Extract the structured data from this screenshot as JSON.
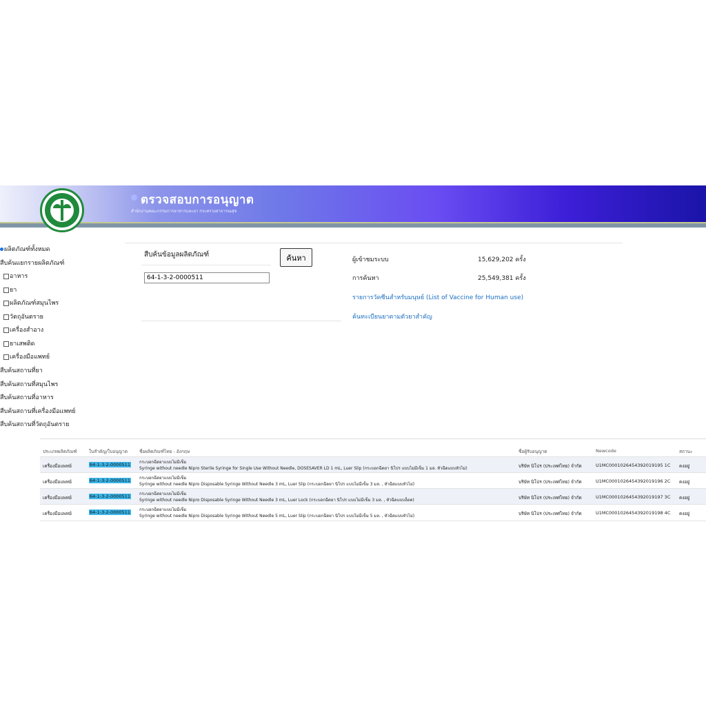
{
  "header": {
    "title": "ตรวจสอบการอนุญาต",
    "subtitle": "สำนักงานคณะกรรมการอาหารและยา กระทรวงสาธารณสุข"
  },
  "sidebar": {
    "items": [
      {
        "label": "ผลิตภัณฑ์ทั้งหมด",
        "control": "radio"
      },
      {
        "label": "สืบค้นแยกรายผลิตภัณฑ์",
        "control": "none"
      },
      {
        "label": "อาหาร",
        "control": "checkbox"
      },
      {
        "label": "ยา",
        "control": "checkbox"
      },
      {
        "label": "ผลิตภัณฑ์สมุนไพร",
        "control": "checkbox"
      },
      {
        "label": "วัตถุอันตราย",
        "control": "checkbox"
      },
      {
        "label": "เครื่องสำอาง",
        "control": "checkbox"
      },
      {
        "label": "ยาเสพติด",
        "control": "checkbox"
      },
      {
        "label": "เครื่องมือแพทย์",
        "control": "checkbox"
      },
      {
        "label": "สืบค้นสถานที่ยา",
        "control": "none"
      },
      {
        "label": "สืบค้นสถานที่สมุนไพร",
        "control": "none"
      },
      {
        "label": "สืบค้นสถานที่อาหาร",
        "control": "none"
      },
      {
        "label": "สืบค้นสถานที่เครื่องมือแพทย์",
        "control": "none"
      },
      {
        "label": "สืบค้นสถานที่วัตถุอันตราย",
        "control": "none"
      }
    ]
  },
  "search": {
    "label": "สืบค้นข้อมูลผลิตภัณฑ์",
    "value": "64-1-3-2-0000511",
    "button": "ค้นหา"
  },
  "stats": {
    "visitors_label": "ผู้เข้าชมระบบ",
    "visitors_value": "15,629,202 ครั้ง",
    "searches_label": "การค้นหา",
    "searches_value": "25,549,381 ครั้ง",
    "link_vaccine": "รายการวัคซีนสำหรับมนุษย์ (List of Vaccine for Human use)",
    "link_drug": "ค้นทะเบียนยาตามตัวยาสำคัญ"
  },
  "table": {
    "headers": [
      "ประเภทผลิตภัณฑ์",
      "ใบสำคัญ/ใบอนุญาต",
      "ชื่อผลิตภัณฑ์ไทย - อังกฤษ",
      "ชื่อผู้รับอนุญาต",
      "Newcode",
      "สถานะ"
    ],
    "rows": [
      {
        "type": "เครื่องมือแพทย์",
        "reg": "64-1-3-2-0000511",
        "name_th": "กระบอกฉีดยาแบบไม่มีเข็ม",
        "name_en": "Syringe without needle Nipro Sterile Syringe for Single Use Without Needle, DOSESAVER LD 1 mL, Luer Slip (กระบอกฉีดยา นิโปร แบบไม่มีเข็ม 1 มล. หัวฉีดแบบหัวไม่)",
        "licensee": "บริษัท นิโปร (ประเทศไทย) จำกัด",
        "newcode": "U1MC0001026454392019195 1C",
        "status": "คงอยู่"
      },
      {
        "type": "เครื่องมือแพทย์",
        "reg": "64-1-3-2-0000511",
        "name_th": "กระบอกฉีดยาแบบไม่มีเข็ม",
        "name_en": "Syringe without needle Nipro Disposable Syringe Without Needle 3 mL, Luer Slip (กระบอกฉีดยา นิโปร แบบไม่มีเข็ม 3 มล. , หัวฉีดแบบหัวไม่)",
        "licensee": "บริษัท นิโปร (ประเทศไทย) จำกัด",
        "newcode": "U1MC0001026454392019196 2C",
        "status": "คงอยู่"
      },
      {
        "type": "เครื่องมือแพทย์",
        "reg": "64-1-3-2-0000511",
        "name_th": "กระบอกฉีดยาแบบไม่มีเข็ม",
        "name_en": "Syringe without needle Nipro Disposable Syringe Without Needle 3 mL, Luer Lock (กระบอกฉีดยา นิโปร แบบไม่มีเข็ม 3 มล. , หัวฉีดแบบล็อค)",
        "licensee": "บริษัท นิโปร (ประเทศไทย) จำกัด",
        "newcode": "U1MC0001026454392019197 3C",
        "status": "คงอยู่"
      },
      {
        "type": "เครื่องมือแพทย์",
        "reg": "64-1-3-2-0000511",
        "name_th": "กระบอกฉีดยาแบบไม่มีเข็ม",
        "name_en": "Syringe without needle Nipro Disposable Syringe Without Needle 5 mL, Luer Slip (กระบอกฉีดยา นิโปร แบบไม่มีเข็ม 5 มล. , หัวฉีดแบบหัวไม่)",
        "licensee": "บริษัท นิโปร (ประเทศไทย) จำกัด",
        "newcode": "U1MC0001026454392019198 4C",
        "status": "คงอยู่"
      }
    ]
  },
  "colors": {
    "accent": "#1a73e8",
    "link": "#1a6ec0",
    "highlight": "#3bb5e8",
    "logo_green": "#1f8a3c"
  }
}
